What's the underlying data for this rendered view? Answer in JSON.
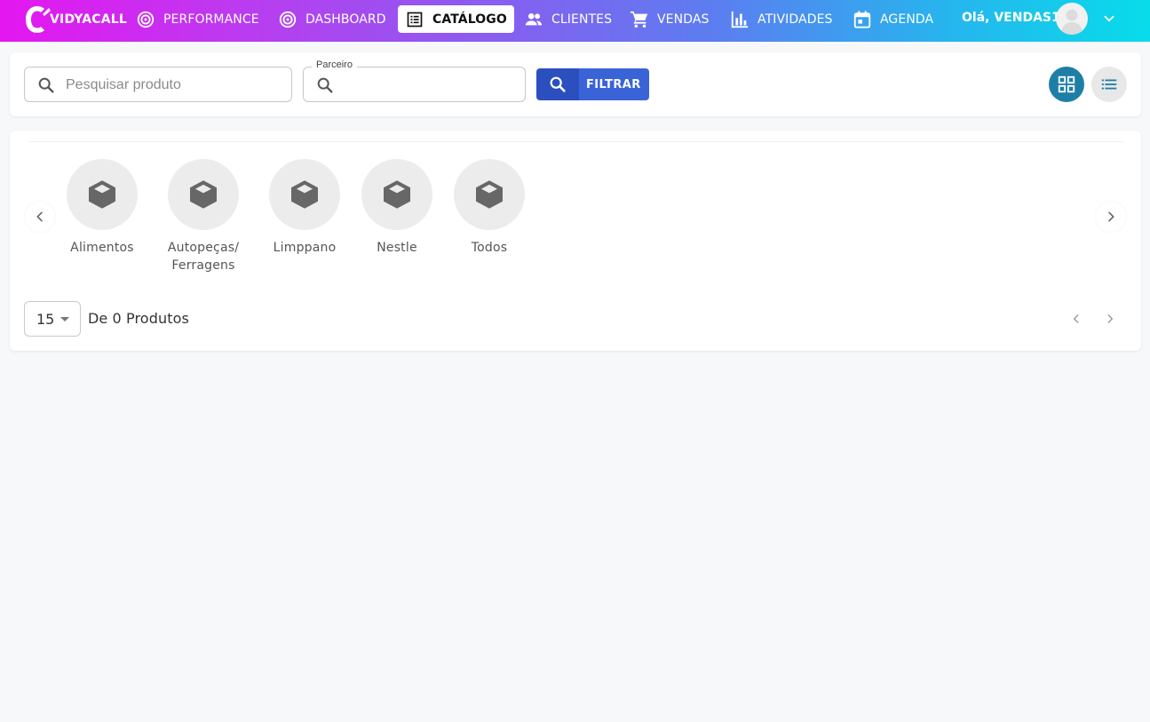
{
  "brand": {
    "name": "VIDYACALL"
  },
  "nav": {
    "items": [
      {
        "label": "PERFORMANCE",
        "icon": "target-icon"
      },
      {
        "label": "DASHBOARD",
        "icon": "target-icon"
      },
      {
        "label": "CATÁLOGO",
        "icon": "list-alt-icon",
        "active": true
      },
      {
        "label": "CLIENTES",
        "icon": "people-icon"
      },
      {
        "label": "VENDAS",
        "icon": "cart-icon"
      },
      {
        "label": "ATIVIDADES",
        "icon": "bar-chart-icon"
      },
      {
        "label": "AGENDA",
        "icon": "calendar-icon"
      }
    ],
    "greeting": "Olá, VENDAS1"
  },
  "filters": {
    "search_placeholder": "Pesquisar produto",
    "partner_label": "Parceiro",
    "partner_value": "",
    "filter_button": "FILTRAR"
  },
  "categories": [
    {
      "label": "Alimentos"
    },
    {
      "label": "Autopeças/ Ferragens"
    },
    {
      "label": "Limppano"
    },
    {
      "label": "Nestle"
    },
    {
      "label": "Todos"
    }
  ],
  "pagination": {
    "per_page": "15",
    "count_text": "De 0 Produtos"
  },
  "colors": {
    "primary": "#3a63d8",
    "grid_view_active": "#1e7fa6"
  }
}
